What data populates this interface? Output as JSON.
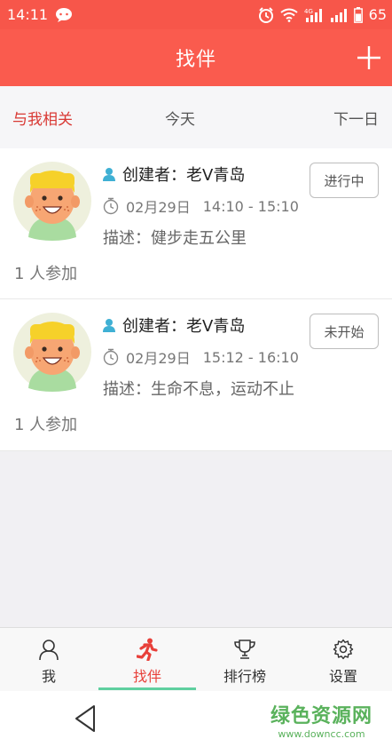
{
  "status_bar": {
    "time": "14:11",
    "signal_label": "4G",
    "battery": "65",
    "icons": [
      "chat-bubble-icon",
      "alarm-icon",
      "wifi-icon",
      "signal-icon",
      "signal-icon",
      "battery-level"
    ]
  },
  "header": {
    "title": "找伴",
    "add_icon": "plus-icon"
  },
  "tabs": {
    "related": "与我相关",
    "today": "今天",
    "next_day": "下一日"
  },
  "events": [
    {
      "creator": "创建者：老V青岛",
      "date": "02月29日",
      "time_range": "14:10 - 15:10",
      "description": "描述：健步走五公里",
      "participants": "1 人参加",
      "status": "进行中"
    },
    {
      "creator": "创建者：老V青岛",
      "date": "02月29日",
      "time_range": "15:12 - 16:10",
      "description": "描述：生命不息，运动不止",
      "participants": "1 人参加",
      "status": "未开始"
    }
  ],
  "bottom_nav": {
    "me": "我",
    "find_partner": "找伴",
    "ranking": "排行榜",
    "settings": "设置"
  },
  "watermark": {
    "main": "绿色资源网",
    "sub": "www.downcc.com"
  },
  "colors": {
    "brand_red": "#fa5b4e",
    "active_tab": "#d93a35",
    "nav_underline": "#5fcf9f",
    "creator_icon": "#3fb0d4"
  }
}
